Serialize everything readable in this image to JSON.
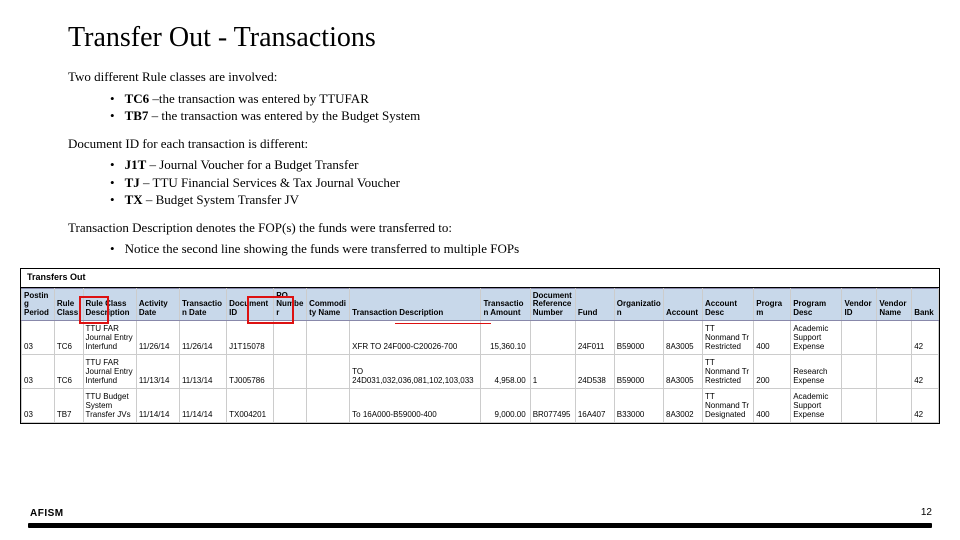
{
  "title": "Transfer Out - Transactions",
  "sections": [
    {
      "lead": "Two different Rule classes are involved:",
      "bullets": [
        {
          "code": "TC6",
          "rest": " –the transaction was entered by TTUFAR"
        },
        {
          "code": "TB7",
          "rest": " – the transaction was entered by the Budget System"
        }
      ]
    },
    {
      "lead": "Document ID for each transaction is different:",
      "bullets": [
        {
          "code": "J1T",
          "rest": " – Journal Voucher for a Budget Transfer"
        },
        {
          "code": "TJ",
          "rest": " – TTU Financial Services & Tax Journal Voucher"
        },
        {
          "code": "TX",
          "rest": " – Budget System Transfer JV"
        }
      ]
    },
    {
      "lead": "Transaction Description denotes the FOP(s) the funds were transferred to:",
      "bullets": [
        {
          "code": "",
          "rest": "Notice the second line showing the funds were transferred to multiple FOPs"
        }
      ]
    }
  ],
  "table": {
    "caption": "Transfers Out",
    "headers": [
      "Posting Period",
      "Rule Class",
      "Rule Class Description",
      "Activity Date",
      "Transaction Date",
      "Document ID",
      "PO Number",
      "Commodity Name",
      "Transaction Description",
      "Transaction Amount",
      "Document Reference Number",
      "Fund",
      "Organization",
      "Account",
      "Account Desc",
      "Program",
      "Program Desc",
      "Vendor ID",
      "Vendor Name",
      "Bank"
    ],
    "rows": [
      {
        "cells": [
          "03",
          "TC6",
          "TTU FAR Journal Entry Interfund",
          "11/26/14",
          "11/26/14",
          "J1T15078",
          "",
          "",
          "XFR TO 24F000-C20026-700",
          "15,360.10",
          "",
          "24F011",
          "B59000",
          "8A3005",
          "TT Nonmand Tr Restricted",
          "400",
          "Academic Support Expense",
          "",
          "",
          "42"
        ]
      },
      {
        "cells": [
          "03",
          "TC6",
          "TTU FAR Journal Entry Interfund",
          "11/13/14",
          "11/13/14",
          "TJ005786",
          "",
          "",
          "TO 24D031,032,036,081,102,103,033",
          "4,958.00",
          "1",
          "24D538",
          "B59000",
          "8A3005",
          "TT Nonmand Tr Restricted",
          "200",
          "Research Expense",
          "",
          "",
          "42"
        ]
      },
      {
        "cells": [
          "03",
          "TB7",
          "TTU Budget System Transfer JVs",
          "11/14/14",
          "11/14/14",
          "TX004201",
          "",
          "",
          "To 16A000-B59000-400",
          "9,000.00",
          "BR077495",
          "16A407",
          "B33000",
          "8A3002",
          "TT Nonmand Tr Designated",
          "400",
          "Academic Support Expense",
          "",
          "",
          "42"
        ]
      }
    ]
  },
  "footer": {
    "logo": "AFISM",
    "page": "12"
  }
}
